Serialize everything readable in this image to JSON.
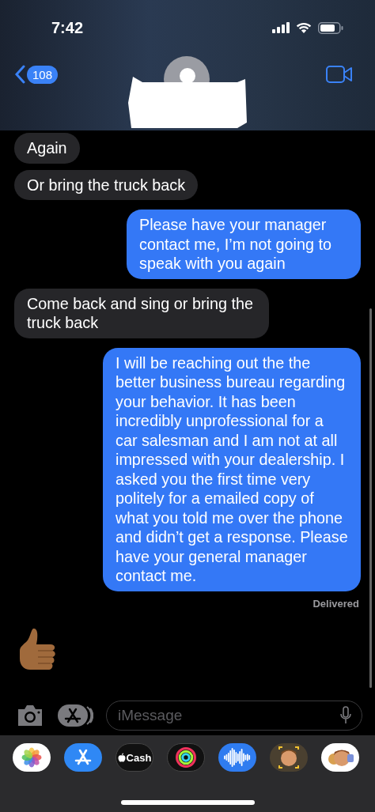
{
  "status_bar": {
    "time": "7:42"
  },
  "nav": {
    "unread_count": "108"
  },
  "messages": [
    {
      "sent": false,
      "kind": "text",
      "text": "Again"
    },
    {
      "sent": false,
      "kind": "text",
      "text": "Or bring the truck back"
    },
    {
      "sent": true,
      "kind": "text",
      "text": "Please have your manager contact me, I’m not going to speak with you again"
    },
    {
      "sent": false,
      "kind": "text",
      "text": "Come back and sing or bring the truck back"
    },
    {
      "sent": true,
      "kind": "text",
      "text": "I will be reaching out the the better business bureau regarding your behavior. It has been incredibly unprofessional for a car salesman and I am not at all impressed with your dealership. I asked you the first time very politely for a emailed copy of what you told me over the phone and didn’t get a response. Please have your general manager contact me.",
      "status": "Delivered"
    },
    {
      "sent": false,
      "kind": "thumbs_up"
    }
  ],
  "composer": {
    "placeholder": "iMessage"
  },
  "app_drawer": [
    {
      "kind": "photos"
    },
    {
      "kind": "app_store"
    },
    {
      "kind": "cash",
      "label": "Cash"
    },
    {
      "kind": "activity"
    },
    {
      "kind": "audio"
    },
    {
      "kind": "memoji"
    },
    {
      "kind": "stickers"
    }
  ]
}
